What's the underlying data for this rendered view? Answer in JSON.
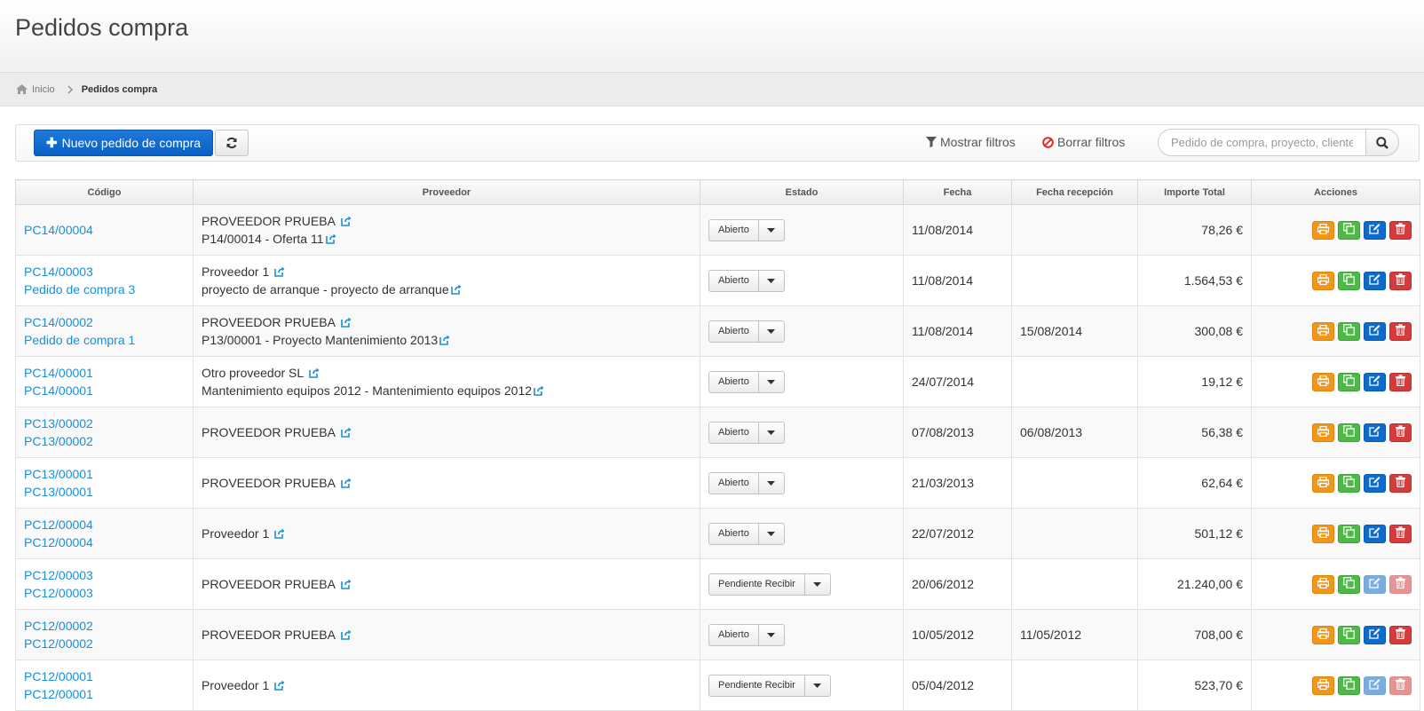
{
  "page": {
    "title": "Pedidos compra"
  },
  "breadcrumb": {
    "home": "Inicio",
    "current": "Pedidos compra"
  },
  "toolbar": {
    "new_label": "Nuevo pedido de compra",
    "show_filters": "Mostrar filtros",
    "clear_filters": "Borrar filtros",
    "search_placeholder": "Pedido de compra, proyecto, cliente"
  },
  "table": {
    "headers": [
      "Código",
      "Proveedor",
      "Estado",
      "Fecha",
      "Fecha recepción",
      "Importe Total",
      "Acciones"
    ],
    "rows": [
      {
        "code": "PC14/00004",
        "name": "",
        "supplier": "PROVEEDOR PRUEBA",
        "project": "P14/00014 - Oferta 11",
        "state": "Abierto",
        "date": "11/08/2014",
        "reception": "",
        "amount": "78,26 €",
        "editable": true
      },
      {
        "code": "PC14/00003",
        "name": "Pedido de compra 3",
        "supplier": "Proveedor 1",
        "project": "proyecto de arranque - proyecto de arranque",
        "state": "Abierto",
        "date": "11/08/2014",
        "reception": "",
        "amount": "1.564,53 €",
        "editable": true
      },
      {
        "code": "PC14/00002",
        "name": "Pedido de compra 1",
        "supplier": "PROVEEDOR PRUEBA",
        "project": "P13/00001 - Proyecto Mantenimiento 2013",
        "state": "Abierto",
        "date": "11/08/2014",
        "reception": "15/08/2014",
        "amount": "300,08 €",
        "editable": true
      },
      {
        "code": "PC14/00001",
        "name": "PC14/00001",
        "supplier": "Otro proveedor SL",
        "project": "Mantenimiento equipos 2012 - Mantenimiento equipos 2012",
        "state": "Abierto",
        "date": "24/07/2014",
        "reception": "",
        "amount": "19,12 €",
        "editable": true
      },
      {
        "code": "PC13/00002",
        "name": "PC13/00002",
        "supplier": "PROVEEDOR PRUEBA",
        "project": "",
        "state": "Abierto",
        "date": "07/08/2013",
        "reception": "06/08/2013",
        "amount": "56,38 €",
        "editable": true
      },
      {
        "code": "PC13/00001",
        "name": "PC13/00001",
        "supplier": "PROVEEDOR PRUEBA",
        "project": "",
        "state": "Abierto",
        "date": "21/03/2013",
        "reception": "",
        "amount": "62,64 €",
        "editable": true
      },
      {
        "code": "PC12/00004",
        "name": "PC12/00004",
        "supplier": "Proveedor 1",
        "project": "",
        "state": "Abierto",
        "date": "22/07/2012",
        "reception": "",
        "amount": "501,12 €",
        "editable": true
      },
      {
        "code": "PC12/00003",
        "name": "PC12/00003",
        "supplier": "PROVEEDOR PRUEBA",
        "project": "",
        "state": "Pendiente Recibir",
        "date": "20/06/2012",
        "reception": "",
        "amount": "21.240,00 €",
        "editable": false
      },
      {
        "code": "PC12/00002",
        "name": "PC12/00002",
        "supplier": "PROVEEDOR PRUEBA",
        "project": "",
        "state": "Abierto",
        "date": "10/05/2012",
        "reception": "11/05/2012",
        "amount": "708,00 €",
        "editable": true
      },
      {
        "code": "PC12/00001",
        "name": "PC12/00001",
        "supplier": "Proveedor 1",
        "project": "",
        "state": "Pendiente Recibir",
        "date": "05/04/2012",
        "reception": "",
        "amount": "523,70 €",
        "editable": false
      }
    ]
  },
  "colors": {
    "link": "#1a8fd8",
    "primary": "#0a5fc4",
    "print": "#f39617",
    "copy": "#4db946",
    "edit": "#0c6bcc",
    "delete": "#d63b3b",
    "danger_icon": "#d9302c"
  },
  "icons": {
    "home": "home-icon",
    "refresh": "refresh-icon",
    "filter": "filter-icon",
    "clear": "ban-icon",
    "search": "search-icon",
    "external": "external-link-icon",
    "print": "print-icon",
    "copy": "copy-icon",
    "edit": "edit-icon",
    "delete": "trash-icon"
  }
}
